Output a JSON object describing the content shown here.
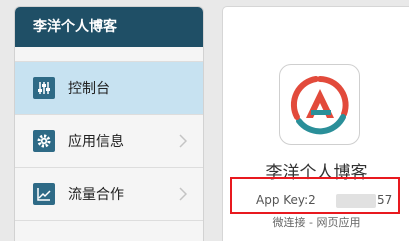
{
  "sidebar": {
    "title": "李洋个人博客",
    "items": [
      {
        "label": "控制台",
        "icon": "sliders-icon",
        "active": true
      },
      {
        "label": "应用信息",
        "icon": "gear-icon",
        "active": false
      },
      {
        "label": "流量合作",
        "icon": "line-chart-icon",
        "active": false
      }
    ]
  },
  "app": {
    "name": "李洋个人博客",
    "key_label": "App Key:2",
    "key_suffix": "57",
    "subtitle": "微连接 - 网页应用",
    "logo_icon": "app-logo-icon"
  },
  "colors": {
    "header_bg": "#1f4f66",
    "active_bg": "#c7e2f1",
    "highlight": "#e8191f",
    "logo_red": "#e24a3b",
    "logo_teal": "#2a8f99"
  }
}
